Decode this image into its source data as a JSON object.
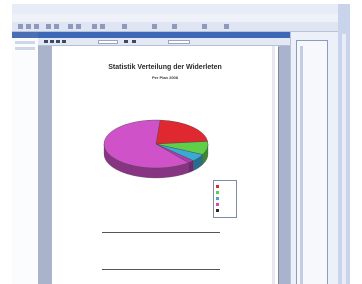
{
  "window": {
    "title": "",
    "menu_items": []
  },
  "report": {
    "title": "Statistik Verteilung der Widerleten",
    "subtitle": "Per Plan 2008",
    "corner_meta": [
      "",
      ""
    ]
  },
  "chart_data": {
    "type": "pie",
    "title": "",
    "slices": [
      {
        "label": "",
        "value": 22,
        "color": "#e02830"
      },
      {
        "label": "",
        "value": 9,
        "color": "#5fcf4a"
      },
      {
        "label": "",
        "value": 5,
        "color": "#3aa9d6"
      },
      {
        "label": "",
        "value": 2,
        "color": "#b13bb0"
      },
      {
        "label": "",
        "value": 62,
        "color": "#cf52c8"
      }
    ]
  },
  "legend": {
    "items": [
      {
        "label": "",
        "color": "#e02830"
      },
      {
        "label": "",
        "color": "#5fcf4a"
      },
      {
        "label": "",
        "color": "#3aa9d6"
      },
      {
        "label": "",
        "color": "#d04cc7"
      },
      {
        "label": "",
        "color": "#2b2b2b"
      }
    ]
  },
  "table": {
    "headers": [
      "",
      "",
      ""
    ],
    "rows": [
      [
        "",
        "",
        ""
      ],
      [
        "",
        "",
        ""
      ],
      [
        "",
        "",
        ""
      ],
      [
        "",
        "",
        ""
      ],
      [
        "",
        "",
        ""
      ],
      [
        "",
        "",
        ""
      ]
    ],
    "total": [
      "",
      "",
      ""
    ]
  }
}
